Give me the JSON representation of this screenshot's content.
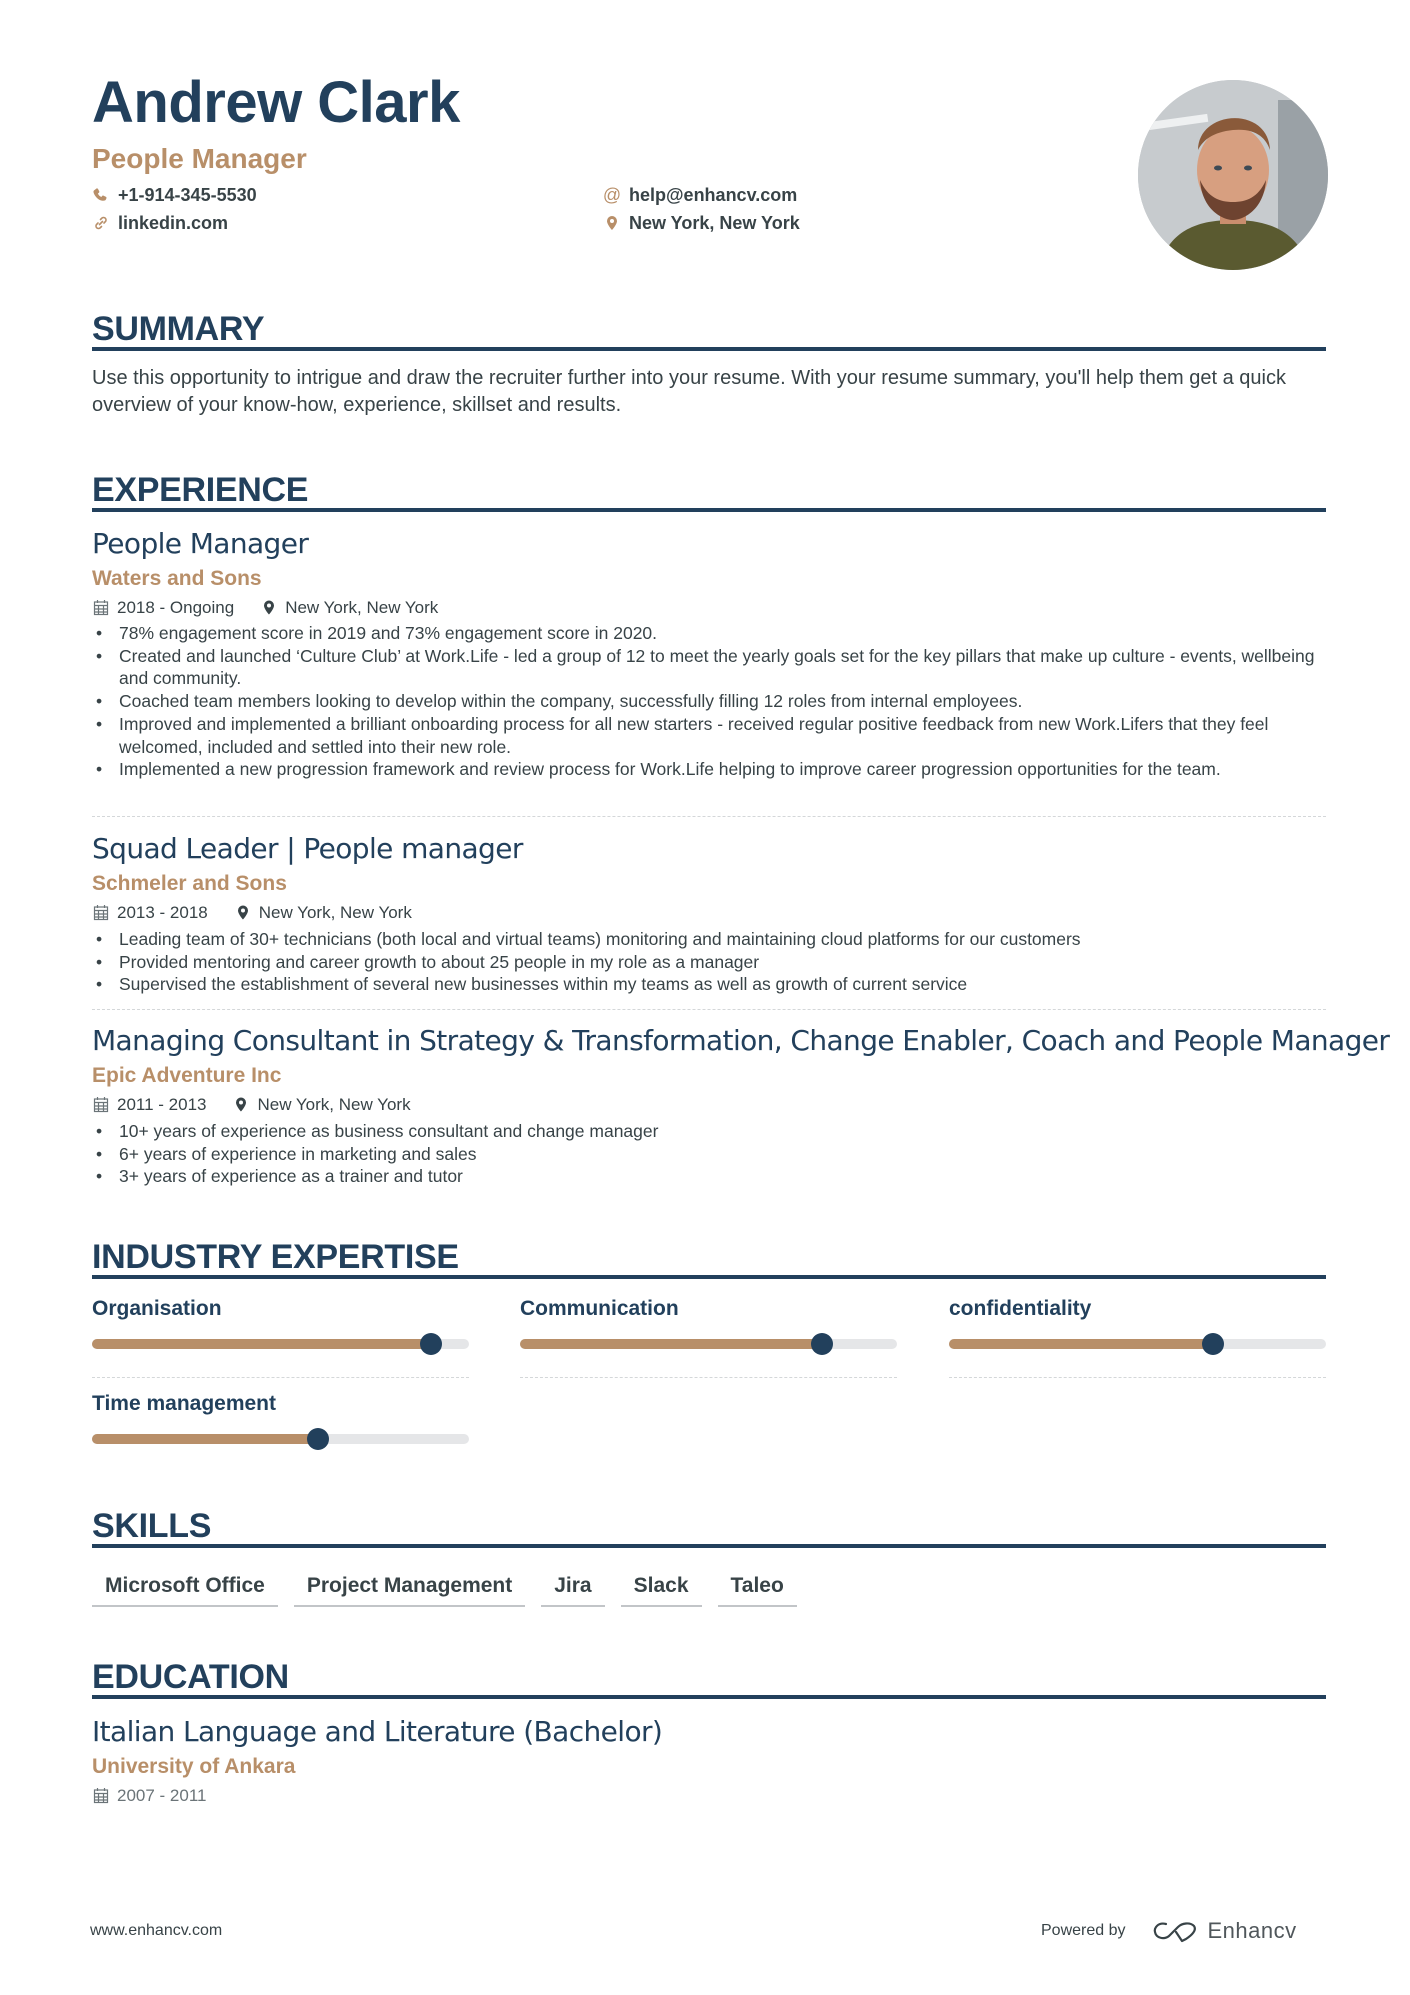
{
  "header": {
    "name": "Andrew Clark",
    "title": "People Manager",
    "contacts": {
      "phone": "+1-914-345-5530",
      "email": "help@enhancv.com",
      "linkedin": "linkedin.com",
      "location": "New York, New York"
    },
    "photo_icon": "profile-photo"
  },
  "colors": {
    "primary": "#22405c",
    "accent": "#b88f69",
    "text": "#384347",
    "track": "#e5e6e8"
  },
  "summary": {
    "heading": "SUMMARY",
    "text": "Use this opportunity to intrigue and draw the recruiter further into your resume. With your resume summary, you'll help them get a quick overview of your know-how, experience, skillset and results."
  },
  "experience": {
    "heading": "EXPERIENCE",
    "jobs": [
      {
        "title": "People Manager",
        "company": "Waters and Sons",
        "dates": "2018 - Ongoing",
        "location": "New York, New York",
        "bullets": [
          "78% engagement score in 2019 and 73% engagement score in 2020.",
          "Created and launched ‘Culture Club’ at Work.Life - led a group of 12 to meet the yearly goals set for the key pillars that make up culture - events, wellbeing and community.",
          "Coached team members looking to develop within the company, successfully filling 12 roles from internal employees.",
          "Improved and implemented a brilliant onboarding process for all new starters - received regular positive feedback from new Work.Lifers that they feel welcomed, included and settled into their new role.",
          "Implemented a new progression framework and review process for Work.Life helping to improve career progression opportunities for the team."
        ]
      },
      {
        "title": "Squad Leader | People manager",
        "company": "Schmeler and Sons",
        "dates": "2013 - 2018",
        "location": "New York, New York",
        "bullets": [
          "Leading team of 30+ technicians (both local and virtual teams) monitoring and maintaining cloud platforms for our customers",
          "Provided mentoring and career growth to about 25 people in my role as a manager",
          "Supervised the establishment of several new businesses within my teams as well as growth of current service"
        ]
      },
      {
        "title": "Managing Consultant in Strategy & Transformation, Change Enabler, Coach and People Manager",
        "company": "Epic Adventure Inc",
        "dates": "2011 - 2013",
        "location": "New York, New York",
        "bullets": [
          "10+ years of experience as business consultant and change manager",
          "6+ years of experience in marketing and sales",
          "3+ years of experience as a trainer and tutor"
        ]
      }
    ]
  },
  "expertise": {
    "heading": "INDUSTRY EXPERTISE",
    "items": [
      {
        "label": "Organisation",
        "level_percent": 90
      },
      {
        "label": "Communication",
        "level_percent": 80
      },
      {
        "label": "confidentiality",
        "level_percent": 70
      },
      {
        "label": "Time management",
        "level_percent": 60
      }
    ]
  },
  "skills": {
    "heading": "SKILLS",
    "tags": [
      "Microsoft Office",
      "Project Management",
      "Jira",
      "Slack",
      "Taleo"
    ]
  },
  "education": {
    "heading": "EDUCATION",
    "items": [
      {
        "degree": "Italian Language and Literature (Bachelor)",
        "school": "University of Ankara",
        "dates": "2007 - 2011"
      }
    ]
  },
  "footer": {
    "website": "www.enhancv.com",
    "powered_by": "Powered by",
    "brand": "Enhancv"
  }
}
